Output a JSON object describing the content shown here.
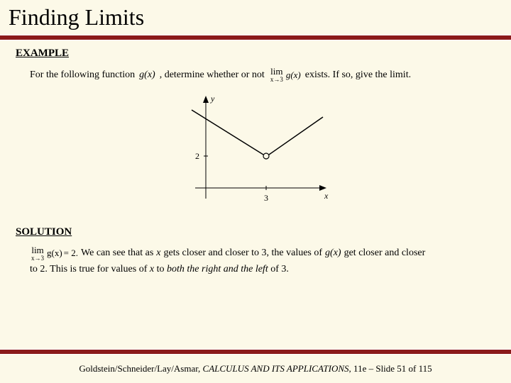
{
  "title": "Finding Limits",
  "example": {
    "heading": "EXAMPLE",
    "pre_text": "For the following function ",
    "func": "g(x)",
    "mid_text": ", determine whether or not",
    "limit": {
      "lim": "lim",
      "sub": "x→3",
      "func": "g(x)"
    },
    "post_text": "exists.  If so, give the limit."
  },
  "graph": {
    "y_label": "y",
    "x_label": "x",
    "y_tick": "2",
    "x_tick": "3"
  },
  "solution": {
    "heading": "SOLUTION",
    "limit": {
      "lim": "lim",
      "sub": "x→3",
      "func": "g(x)",
      "eq": "= 2."
    },
    "line1_a": "We can see that as ",
    "line1_b": "x",
    "line1_c": " gets closer and closer to 3, the values of ",
    "line1_d": "g(x)",
    "line1_e": " get closer and closer",
    "line2_a": "to 2.  This is true for values of ",
    "line2_b": "x",
    "line2_c": " to ",
    "line2_d": "both the right and the left",
    "line2_e": " of 3."
  },
  "footer": {
    "authors": "Goldstein/Schneider/Lay/Asmar, ",
    "book": "CALCULUS AND ITS APPLICATIONS",
    "rest": ", 11e – Slide 51 of 115"
  }
}
